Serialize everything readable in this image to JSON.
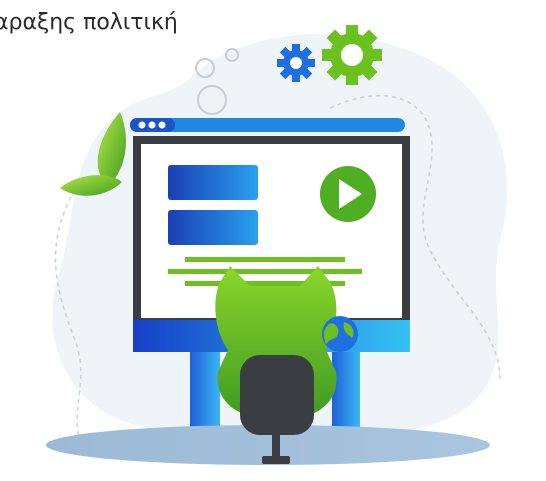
{
  "header": {
    "title_fragment": "αραξης πολιτική"
  },
  "illustration": {
    "window_dots": 3,
    "colors": {
      "background_blob": "#eef4f8",
      "monitor_frame": "#3a3d42",
      "monitor_stand": "#1e88e5",
      "accent_green": "#6cc020",
      "accent_blue": "#1e6fe0",
      "chair": "#3a3d42"
    },
    "icons": [
      "gear-icon",
      "gear-icon",
      "play-icon",
      "leaf-icon",
      "globe-icon",
      "window-dots-icon"
    ]
  }
}
